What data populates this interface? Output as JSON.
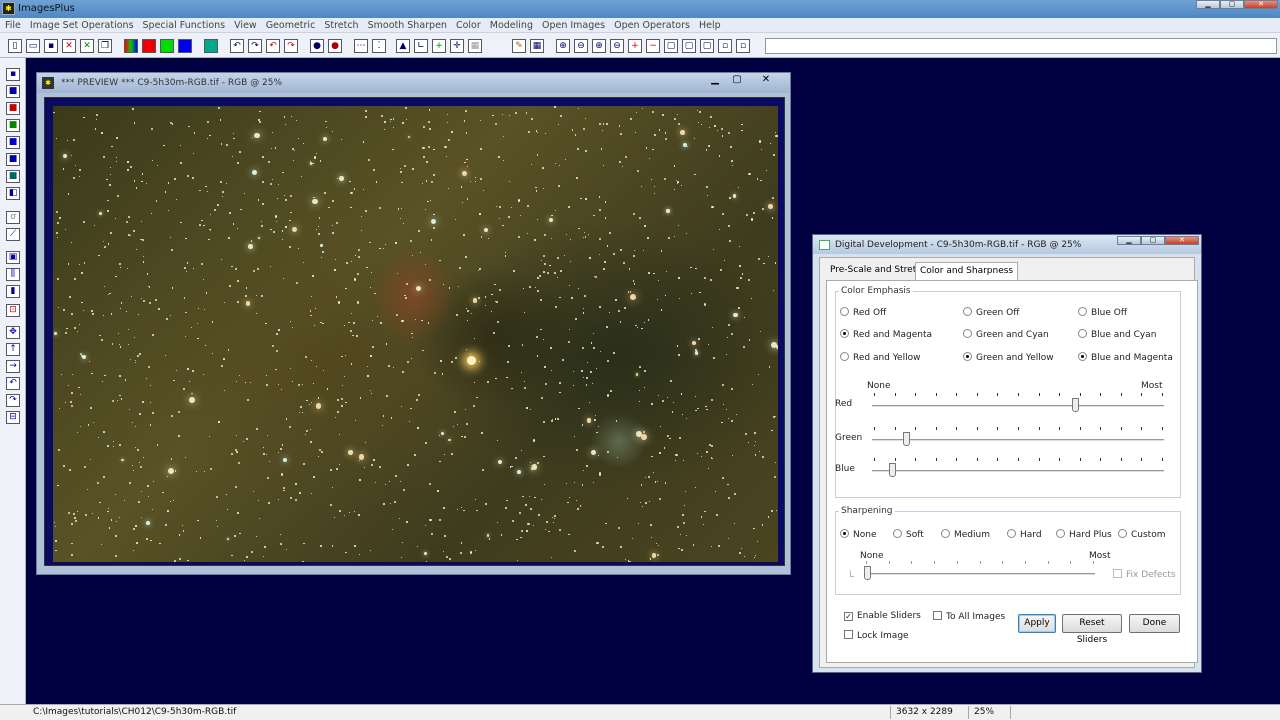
{
  "app": {
    "title": "ImagesPlus"
  },
  "menu": [
    "File",
    "Image Set Operations",
    "Special Functions",
    "View",
    "Geometric",
    "Stretch",
    "Smooth Sharpen",
    "Color",
    "Modeling",
    "Open Images",
    "Open Operators",
    "Help"
  ],
  "preview": {
    "title": "*** PREVIEW *** C9-5h30m-RGB.tif - RGB @ 25%"
  },
  "dialog": {
    "title": "Digital Development - C9-5h30m-RGB.tif - RGB @ 25%",
    "tabs": [
      "Pre-Scale and Stretch",
      "Color and Sharpness"
    ],
    "active_tab": "Color and Sharpness",
    "color_emphasis": {
      "label": "Color Emphasis",
      "options": [
        {
          "label": "Red Off",
          "selected": false
        },
        {
          "label": "Green Off",
          "selected": false
        },
        {
          "label": "Blue Off",
          "selected": false
        },
        {
          "label": "Red and Magenta",
          "selected": true
        },
        {
          "label": "Green and Cyan",
          "selected": false
        },
        {
          "label": "Blue and Cyan",
          "selected": false
        },
        {
          "label": "Red and Yellow",
          "selected": false
        },
        {
          "label": "Green and Yellow",
          "selected": true
        },
        {
          "label": "Blue and Magenta",
          "selected": true
        }
      ],
      "scale_min": "None",
      "scale_max": "Most",
      "sliders": [
        {
          "label": "Red",
          "value": 0.7
        },
        {
          "label": "Green",
          "value": 0.11
        },
        {
          "label": "Blue",
          "value": 0.06
        }
      ]
    },
    "sharpening": {
      "label": "Sharpening",
      "options": [
        {
          "label": "None",
          "selected": true
        },
        {
          "label": "Soft",
          "selected": false
        },
        {
          "label": "Medium",
          "selected": false
        },
        {
          "label": "Hard",
          "selected": false
        },
        {
          "label": "Hard Plus",
          "selected": false
        },
        {
          "label": "Custom",
          "selected": false
        }
      ],
      "scale_min": "None",
      "scale_max": "Most",
      "slider_value": 0.0,
      "fix_defects": "Fix Defects",
      "slider_caption": "L"
    },
    "checks": {
      "enable_sliders": {
        "label": "Enable Sliders",
        "checked": true
      },
      "to_all_images": {
        "label": "To All Images",
        "checked": false
      },
      "lock_image": {
        "label": "Lock Image",
        "checked": false
      }
    },
    "buttons": {
      "apply": "Apply",
      "reset": "Reset Sliders",
      "done": "Done"
    }
  },
  "status": {
    "path": "C:\\Images\\tutorials\\CH012\\C9-5h30m-RGB.tif",
    "dimensions": "3632 x 2289",
    "zoom": "25%"
  }
}
